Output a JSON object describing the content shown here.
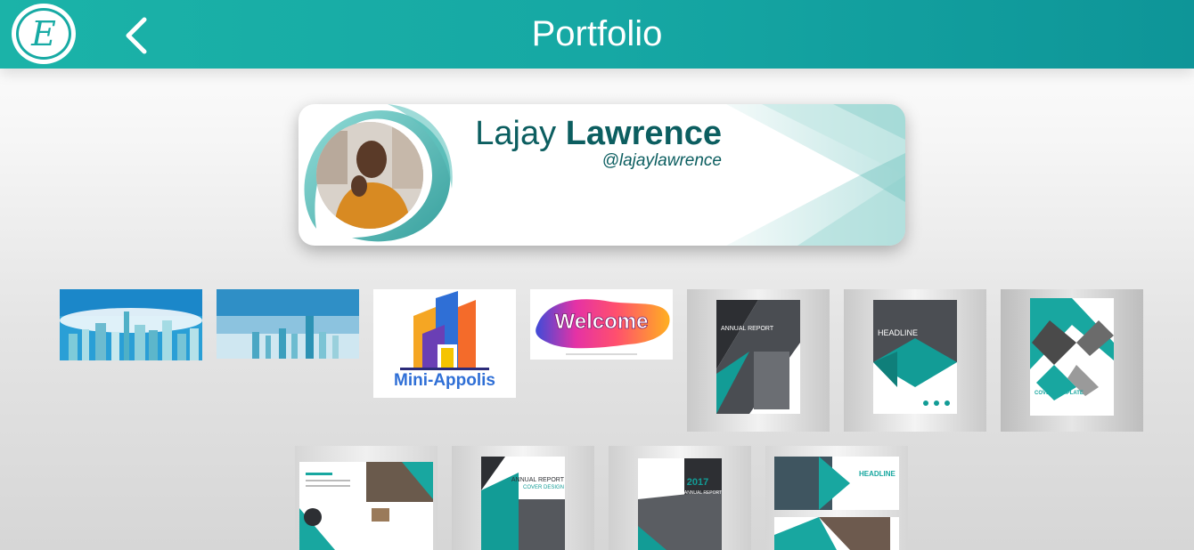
{
  "header": {
    "title": "Portfolio",
    "logo_letter": "E",
    "back_icon": "chevron-left-icon"
  },
  "profile": {
    "first_name": "Lajay",
    "last_name": "Lawrence",
    "handle": "@lajaylawrence"
  },
  "gallery": {
    "row1": [
      {
        "name": "city-skyline-1"
      },
      {
        "name": "city-skyline-2"
      },
      {
        "name": "mini-appolis-logo",
        "text": "Mini-Appolis"
      },
      {
        "name": "welcome-banner",
        "text": "Welcome"
      },
      {
        "name": "annual-report-1",
        "text": "ANNUAL REPORT"
      },
      {
        "name": "headline-brochure-1",
        "text": "HEADLINE"
      },
      {
        "name": "cover-template",
        "text": "COVER TEMPLATE"
      }
    ],
    "row2": [
      {
        "name": "brochure-spread"
      },
      {
        "name": "annual-report-cover-design",
        "text": "ANNUAL REPORT",
        "sub": "COVER DESIGN"
      },
      {
        "name": "annual-report-2017",
        "text": "2017",
        "sub": "ANNUAL REPORT"
      },
      {
        "name": "headline-brochure-2",
        "text": "HEADLINE"
      }
    ]
  },
  "colors": {
    "brand_teal": "#17aaa4",
    "name_text": "#0c5e60"
  }
}
